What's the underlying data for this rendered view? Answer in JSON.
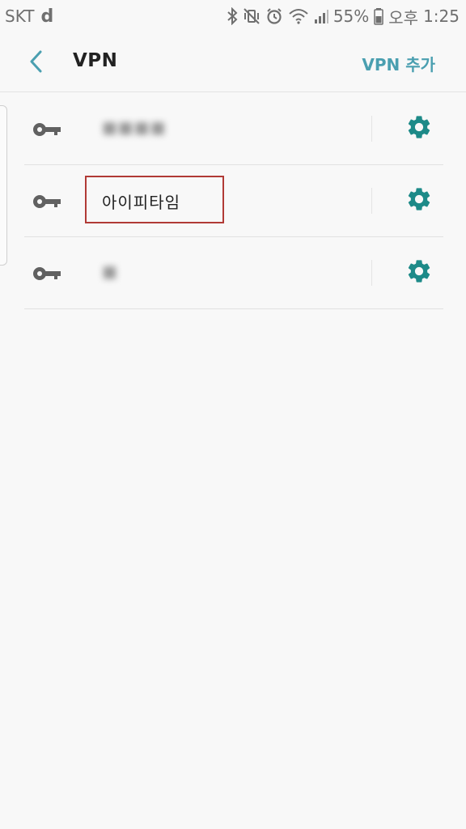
{
  "status_bar": {
    "carrier": "SKT",
    "carrier_logo": "d",
    "battery": "55%",
    "ampm": "오후",
    "time": "1:25",
    "icons": [
      "bluetooth-icon",
      "vibrate-mute-icon",
      "alarm-icon",
      "wifi-icon",
      "signal-icon",
      "battery-icon"
    ]
  },
  "app_bar": {
    "title": "VPN",
    "action_label": "VPN 추가",
    "back_icon": "chevron-left-icon"
  },
  "vpn_list": [
    {
      "name": "■■■■",
      "obscured": true,
      "icon": "key-icon",
      "action_icon": "gear-icon"
    },
    {
      "name": "아이피타임",
      "obscured": false,
      "highlighted": true,
      "icon": "key-icon",
      "action_icon": "gear-icon"
    },
    {
      "name": "■",
      "obscured": true,
      "icon": "key-icon",
      "action_icon": "gear-icon"
    }
  ],
  "colors": {
    "accent": "#4a9fb0",
    "gear": "#1d8a88",
    "key": "#616161",
    "highlight_border": "#b13a36",
    "background": "#f8f8f8"
  }
}
